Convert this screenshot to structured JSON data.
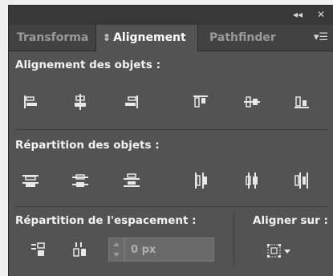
{
  "titlebar": {
    "collapse_glyph": "◂◂",
    "close_glyph": "✕"
  },
  "tabs": [
    {
      "label": "Transforma",
      "active": false
    },
    {
      "label": "Alignement",
      "active": true,
      "arrows": "⇕"
    },
    {
      "label": "Pathfinder",
      "active": false
    }
  ],
  "panel_menu_glyph": "▾☰",
  "sections": {
    "align_objects": "Alignement des objets :",
    "distribute_objects": "Répartition des objets :",
    "distribute_spacing": "Répartition de l'espacement :",
    "align_to": "Aligner sur :"
  },
  "spacing": {
    "value": "0 px"
  },
  "icons": {
    "align": [
      "align-left-icon",
      "align-horizontal-center-icon",
      "align-right-icon",
      "align-top-icon",
      "align-vertical-center-icon",
      "align-bottom-icon"
    ],
    "distribute": [
      "distribute-top-icon",
      "distribute-vertical-center-icon",
      "distribute-bottom-icon",
      "distribute-left-icon",
      "distribute-horizontal-center-icon",
      "distribute-right-icon"
    ]
  },
  "colors": {
    "panel": "#535353",
    "header": "#383838",
    "tabs": "#424242",
    "icon": "#e8e8e8"
  }
}
